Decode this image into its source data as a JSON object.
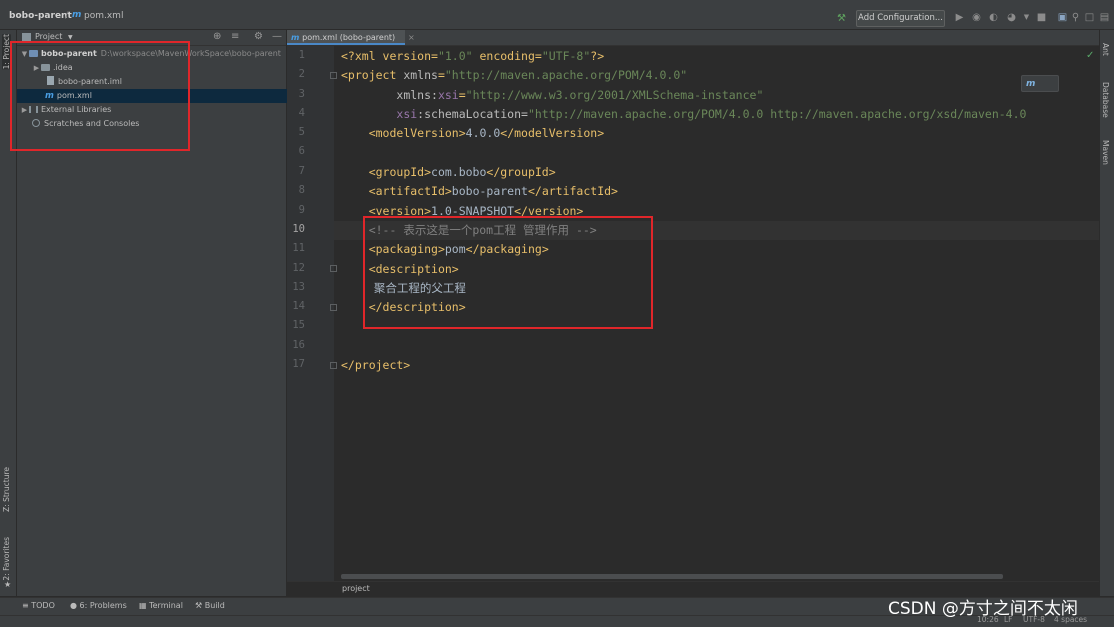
{
  "titlebar": {
    "project": "bobo-parent",
    "file": "pom.xml",
    "add_configuration": "Add Configuration..."
  },
  "left_stripe": {
    "project_tab": "1: Project",
    "structure_tab": "Z: Structure",
    "favorites_tab": "2: Favorites"
  },
  "right_stripe": {
    "ant_tab": "Ant",
    "database_tab": "Database",
    "maven_tab": "Maven"
  },
  "project_panel": {
    "title": "Project",
    "tree": [
      {
        "label": "bobo-parent",
        "hint": "D:\\workspace\\MavenWorkSpace\\bobo-parent"
      },
      {
        "label": ".idea"
      },
      {
        "label": "bobo-parent.iml"
      },
      {
        "label": "pom.xml"
      },
      {
        "label": "External Libraries"
      },
      {
        "label": "Scratches and Consoles"
      }
    ]
  },
  "editor": {
    "tab_label": "pom.xml (bobo-parent)",
    "line_numbers": [
      "1",
      "2",
      "3",
      "4",
      "5",
      "6",
      "7",
      "8",
      "9",
      "10",
      "11",
      "12",
      "13",
      "14",
      "15",
      "16",
      "17"
    ],
    "current_line": 10,
    "line1": {
      "a": "<?xml version=",
      "b": "\"1.0\"",
      "c": " encoding=",
      "d": "\"UTF-8\"",
      "e": "?>"
    },
    "line2": {
      "a": "<project ",
      "b": "xmlns",
      "c": "=",
      "d": "\"http://maven.apache.org/POM/4.0.0\""
    },
    "line3": {
      "a": "xmlns:",
      "b": "xsi",
      "c": "=",
      "d": "\"http://www.w3.org/2001/XMLSchema-instance\""
    },
    "line4": {
      "a": "xsi",
      "b": ":schemaLocation=",
      "c": "\"http://maven.apache.org/POM/4.0.0 http://maven.apache.org/xsd/maven-4.0"
    },
    "line5": {
      "open": "<modelVersion>",
      "value": "4.0.0",
      "close": "</modelVersion>"
    },
    "line7": {
      "open": "<groupId>",
      "value": "com.bobo",
      "close": "</groupId>"
    },
    "line8": {
      "open": "<artifactId>",
      "value": "bobo-parent",
      "close": "</artifactId>"
    },
    "line9": {
      "open": "<version>",
      "value": "1.0-SNAPSHOT",
      "close": "</version>"
    },
    "line10": {
      "comment": "<!-- 表示这是一个pom工程 管理作用 -->"
    },
    "line11": {
      "open": "<packaging>",
      "value": "pom",
      "close": "</packaging>"
    },
    "line12": {
      "open": "<description>"
    },
    "line13": {
      "text": "聚合工程的父工程"
    },
    "line14": {
      "close": "</description>"
    },
    "line17": {
      "close": "</project>"
    },
    "breadcrumb": "project"
  },
  "bottom_tabs": {
    "todo": "TODO",
    "problems_num": "6",
    "problems": "Problems",
    "terminal": "Terminal",
    "build": "Build"
  },
  "status_bar": {
    "position": "10:26",
    "line_sep": "LF",
    "encoding": "UTF-8",
    "indent": "4 spaces"
  },
  "watermark": "CSDN @方寸之间不太闲",
  "colors": {
    "highlight_box": "#e0262a",
    "accent": "#4a88c7"
  },
  "icons": [
    "hammer-icon",
    "run-icon",
    "debug-icon",
    "gear-icon",
    "locate-icon",
    "collapse-icon",
    "minimize-icon",
    "check-icon",
    "maven-icon"
  ]
}
